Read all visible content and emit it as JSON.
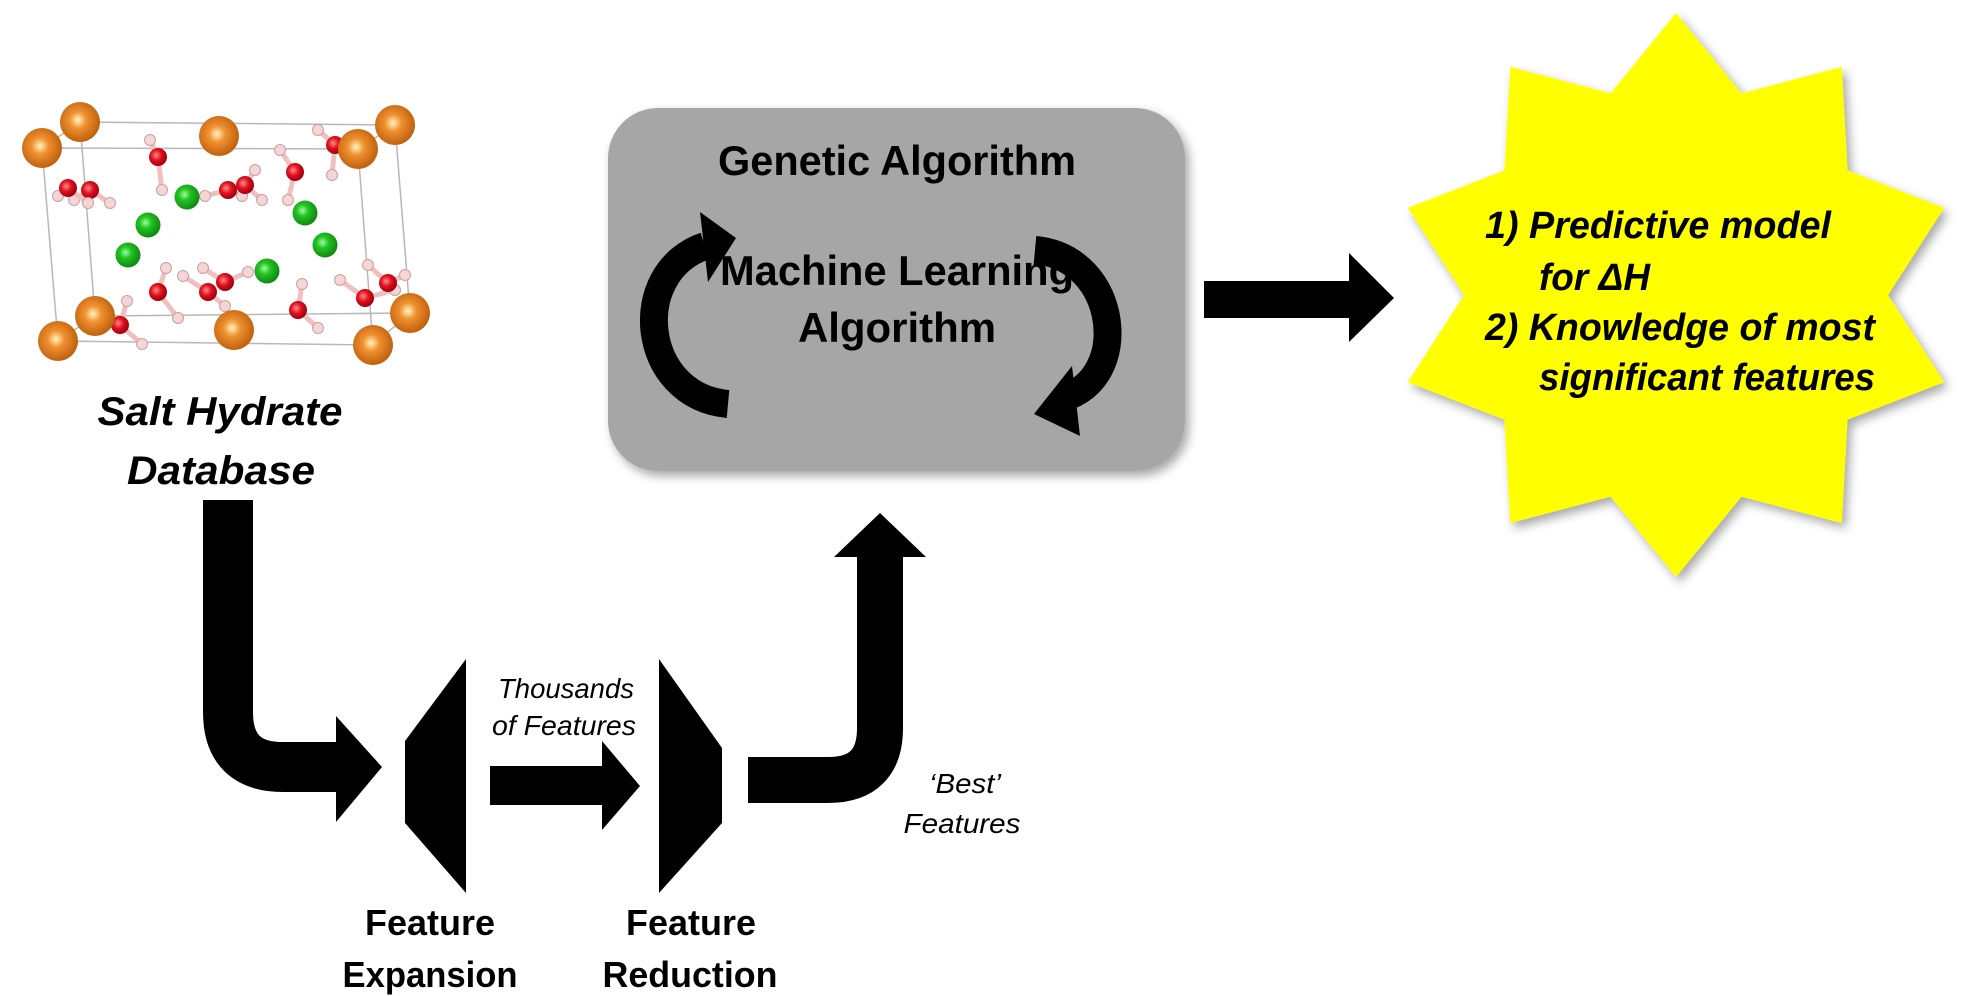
{
  "database": {
    "label_line1": "Salt Hydrate",
    "label_line2": "Database"
  },
  "ga_box": {
    "title": "Genetic Algorithm",
    "ml_line1": "Machine Learning",
    "ml_line2": "Algorithm",
    "color": "#a6a6a6"
  },
  "outcome": {
    "line1": "1)  Predictive model",
    "line2": "for ΔH",
    "line3": "2)  Knowledge of most",
    "line4": "significant features",
    "color": "#ffff00"
  },
  "expansion": {
    "line1": "Feature",
    "line2": "Expansion"
  },
  "reduction": {
    "line1": "Feature",
    "line2": "Reduction"
  },
  "thousands": {
    "line1": "Thousands",
    "line2": "of Features"
  },
  "best": {
    "line1": "‘Best’",
    "line2": "Features"
  },
  "atom_colors": {
    "metal": "#e07b16",
    "chloride": "#22c322",
    "oxygen": "#e0101c",
    "hydrogen": "#f4d6d6"
  }
}
